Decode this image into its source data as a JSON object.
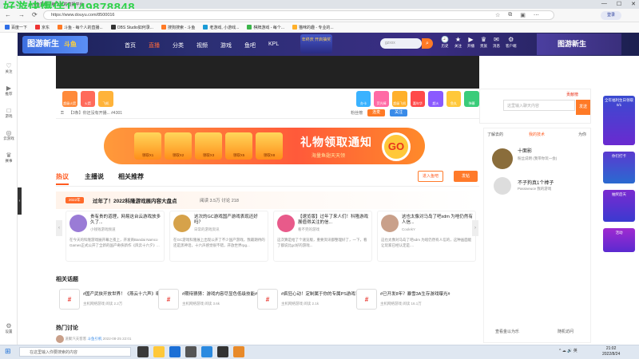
{
  "watermark": "好游快爆伴1149878848",
  "window": {
    "tab_title": "斗鱼直播 - 每个人的直播平台"
  },
  "address_bar": {
    "url": "https://www.douyu.com/8500016",
    "login_label": "登录"
  },
  "bookmarks": [
    "百度一下",
    "京东",
    "斗鱼 - 每个人的直播...",
    "OBS Studio如何录...",
    "搜狗搜索 - 斗鱼",
    "老游戏, 小游戏...",
    "棋牌游戏 - 每个...",
    "猫咪的趣 - 专业的..."
  ],
  "topnav": {
    "logo_text": "图游新生",
    "logo_tag": "斗鱼",
    "links": [
      "首页",
      "直播",
      "分类",
      "视频",
      "游戏",
      "鱼吧",
      "KPL"
    ],
    "active_link": "直播",
    "promo": "年终庆 开启抽奖",
    "search_placeholder": "gzxxx",
    "right_items": [
      {
        "icon": "🕘",
        "label": "历史"
      },
      {
        "icon": "★",
        "label": "关注"
      },
      {
        "icon": "▶",
        "label": "开播"
      },
      {
        "icon": "♛",
        "label": "贵族"
      },
      {
        "icon": "✉",
        "label": "消息"
      },
      {
        "icon": "⚙",
        "label": "客户端"
      }
    ],
    "banner_text": "图游新生"
  },
  "left_rail": [
    {
      "icon": "♡",
      "label": "关注"
    },
    {
      "icon": "▶",
      "label": "推荐"
    },
    {
      "icon": "□",
      "label": "游戏"
    },
    {
      "icon": "◎",
      "label": "云游戏"
    },
    {
      "icon": "♛",
      "label": "赛事"
    },
    {
      "icon": "⚙",
      "label": "设置"
    }
  ],
  "gift_labels": [
    "超级火箭",
    "火箭",
    "飞机",
    "办卡",
    "荧光棒",
    "超级飞机",
    "嘉年华",
    "超火",
    "鱼丸",
    "弹幕"
  ],
  "status_row": {
    "text": "【3条】你还没有开播... #4301",
    "fan_label": "粉丝榜",
    "btn1": "连麦",
    "btn2": "关注"
  },
  "chat": {
    "placeholder": "这里输入聊天内容",
    "send_label": "发送",
    "header": "贡献榜"
  },
  "banner_ad": {
    "title": "礼物领取通知",
    "subtitle": "海量鱼翅天天领",
    "go_label": "GO",
    "slots": [
      "领取X1",
      "领取X2",
      "领取X3",
      "领取X5",
      "领取X8",
      "领取X1"
    ]
  },
  "content_tabs": {
    "items": [
      "热议",
      "主播说",
      "相关推荐"
    ],
    "active": "热议",
    "filter_label": "进入鱼吧",
    "post_label": "发帖"
  },
  "hot_topic": {
    "badge": "2022年",
    "title": "过年了！2022科隆游戏展内容大盘点",
    "stats": "阅读 3.5万  讨论 218"
  },
  "posts": [
    {
      "title": "贵有贵的道理，网易这台云游戏放多久了...",
      "user": "小钱钱游戏频道",
      "body": "在今天的科隆游戏展开幕之夜上，开发商Bandai Namco Games正式公开了全新的国产奇侠新作《风云十六夕》..."
    },
    {
      "title": "这次的GC游戏国产游戏表现还好吗？",
      "user": "日常的游戏资讯",
      "body": "在GC游戏科隆展上出现公开了不少国产游戏，我最期待的还是黑神话，十六声感觉很不错，开放世界rpg..."
    },
    {
      "title": "【速览版】过年了来人们！科隆游戏展值得关注的信...",
      "user": "看不完的游戏",
      "body": "这次算是给了个速览版，重要资讯都整理好了，一下，看了都说比gc好的游戏..."
    },
    {
      "title": "这也太像对马岛了吧xdm 为啥仍然有人信...",
      "user": "CoolekY",
      "body": "这也太像对马岛了吧xdm 为啥仍然有人信的，这种画面能让玩家已经认定是...."
    }
  ],
  "topics": {
    "heading": "相关话题",
    "items": [
      {
        "title": "#国产武侠开放世界！《燕云十六声》曝光#",
        "meta": "主机网络游戏    阅读 2.2万"
      },
      {
        "title": "#期待猜猜：游戏内容尽显色低级技能#",
        "meta": "主机网络游戏    阅读 3.6k"
      },
      {
        "title": "#疯狂心动！定制属于你的专属PS游戏手柄#",
        "meta": "主机网络游戏    阅读 2.1k"
      },
      {
        "title": "#已开发8年？暴雪3A生存游戏曝光#",
        "meta": "主机网络游戏    阅读 16.1万"
      }
    ]
  },
  "discuss": {
    "heading": "热门讨论",
    "user": "道聚汽夫客客",
    "tag": "斗鱼引机",
    "time": "2022-08-25 22:01"
  },
  "right_panel": {
    "tabs": [
      "了解去的",
      "我的技术",
      "为你"
    ],
    "rank1_title": "十面影",
    "rank1_sub": "粉丝说明 (我带你玩一会)",
    "rank2_title": "不子狗真1个棒子",
    "rank2_sub": "Passiveuce 我的游戏",
    "foot_left": "查看金以为乐",
    "foot_right": "随机访问"
  },
  "side_ads": [
    "全年福利生日领取",
    "0/1",
    "你们打卡",
    "抽奖后天",
    "活动"
  ],
  "taskbar": {
    "search_placeholder": "在这里输入你要搜索的内容",
    "time": "21:02",
    "date": "2022/8/24"
  }
}
